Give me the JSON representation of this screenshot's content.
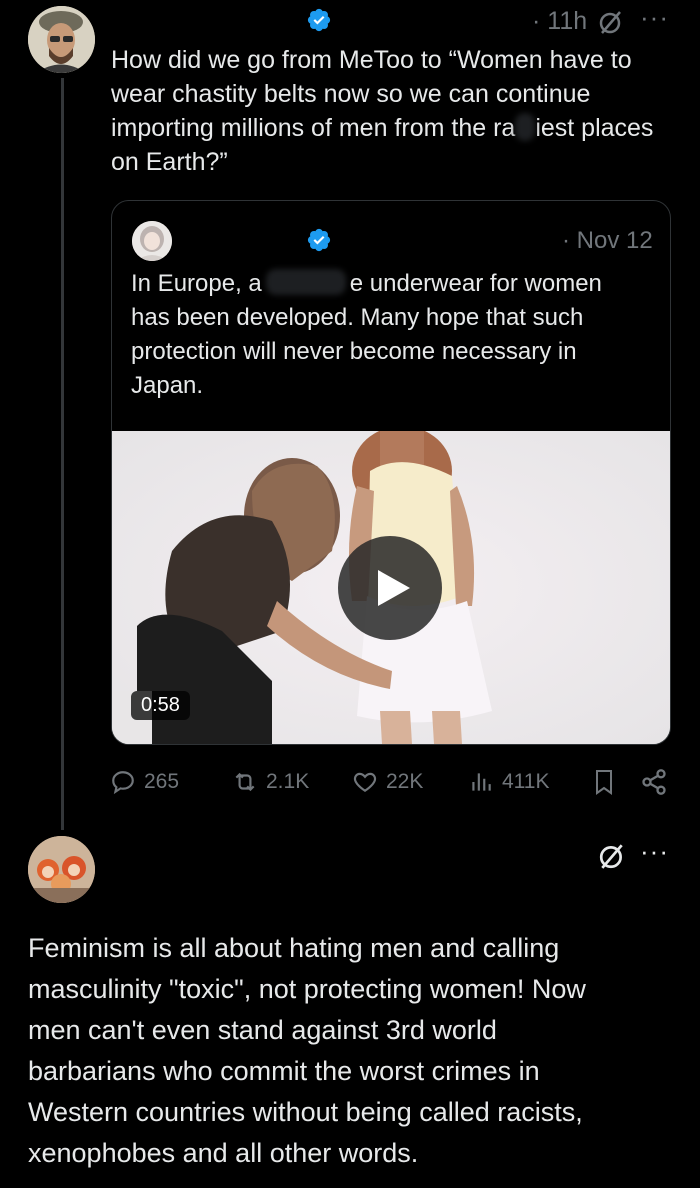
{
  "main_tweet": {
    "avatar": "user-avatar-photo",
    "time": "· 11h",
    "text_line1": "How did we go from MeToo to “Women have to",
    "text_line2": "wear chastity belts now so we can continue",
    "text_line3a": "importing millions of men from the ra",
    "text_line3b": "iest places",
    "text_line4": "on Earth?”"
  },
  "quoted_tweet": {
    "date": "· Nov 12",
    "line1a": "In Europe, a",
    "line1b": "e underwear for women",
    "line2": "has been developed. Many hope that such",
    "line3": "protection will never become necessary in",
    "line4": "Japan.",
    "video_duration": "0:58"
  },
  "actions": {
    "replies": "265",
    "reposts": "2.1K",
    "likes": "22K",
    "views": "411K"
  },
  "reply_tweet": {
    "line1": "Feminism is all about hating men and calling",
    "line2": "masculinity \"toxic\", not protecting women! Now",
    "line3": "men can't even stand against 3rd world",
    "line4": "barbarians who commit the worst crimes in",
    "line5": "Western countries without being called racists,",
    "line6": "xenophobes and all other words."
  },
  "colors": {
    "background": "#000000",
    "text": "#e7e9ea",
    "muted": "#71767b",
    "verified": "#1d9bf0",
    "border": "#2f3336"
  }
}
